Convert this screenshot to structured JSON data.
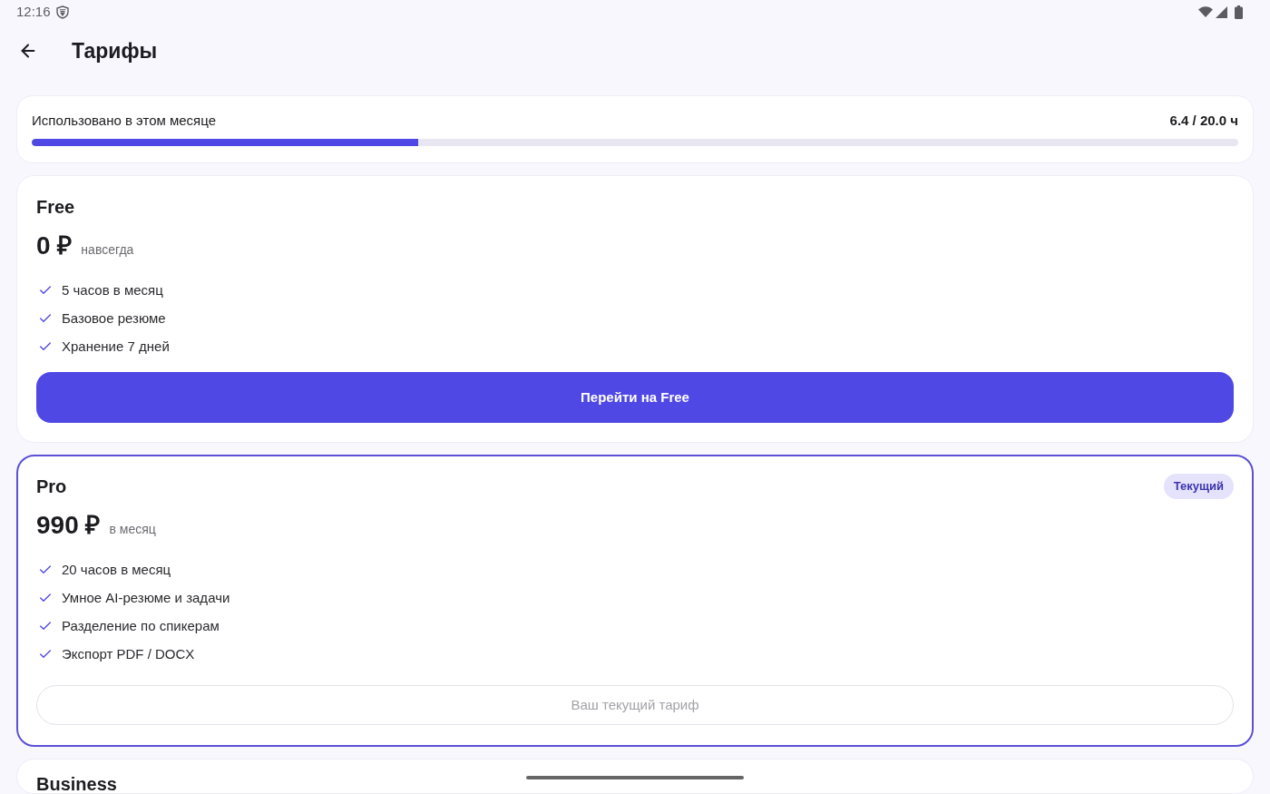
{
  "status_bar": {
    "time": "12:16"
  },
  "header": {
    "title": "Тарифы"
  },
  "usage": {
    "label": "Использовано в этом месяце",
    "reading": "6.4 / 20.0 ч",
    "level": 0.32
  },
  "plans": [
    {
      "name": "Free",
      "price": "0 ₽",
      "period": "навсегда",
      "current": false,
      "features": [
        "5 часов в месяц",
        "Базовое резюме",
        "Хранение 7 дней"
      ],
      "button": {
        "kind": "primary",
        "label": "Перейти на Free",
        "disabled": false
      }
    },
    {
      "name": "Pro",
      "price": "990 ₽",
      "period": "в месяц",
      "current": true,
      "badge": "Текущий",
      "features": [
        "20 часов в месяц",
        "Умное AI-резюме и задачи",
        "Разделение по спикерам",
        "Экспорт PDF / DOCX"
      ],
      "button": {
        "kind": "outlined",
        "label": "Ваш текущий тариф",
        "disabled": true
      }
    },
    {
      "name": "Business",
      "current": false
    }
  ]
}
